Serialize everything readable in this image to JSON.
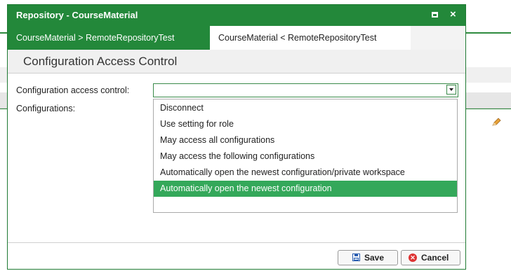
{
  "window": {
    "title": "Repository - CourseMaterial",
    "close_glyph": "×"
  },
  "tabs": [
    {
      "label": "CourseMaterial > RemoteRepositoryTest"
    },
    {
      "label": "CourseMaterial < RemoteRepositoryTest"
    }
  ],
  "section": {
    "title": "Configuration Access Control"
  },
  "form": {
    "access_label": "Configuration access control:",
    "configs_label": "Configurations:",
    "select_value": ""
  },
  "dropdown": {
    "options": [
      {
        "label": "Disconnect"
      },
      {
        "label": "Use setting for role"
      },
      {
        "label": "May access all configurations"
      },
      {
        "label": "May access the following configurations"
      },
      {
        "label": "Automatically open the newest configuration/private workspace"
      },
      {
        "label": "Automatically open the newest configuration"
      }
    ],
    "selected": "Automatically open the newest configuration"
  },
  "footer": {
    "save_label": "Save",
    "cancel_label": "Cancel",
    "cancel_glyph": "✕"
  },
  "colors": {
    "accent": "#23883a",
    "selected_option": "#34a85a"
  }
}
